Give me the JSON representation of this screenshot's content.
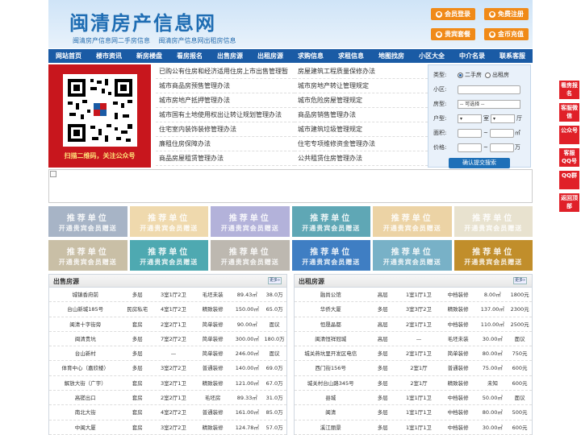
{
  "header": {
    "logo": "闽清房产信息网",
    "tagline": [
      "闽清房产信息网二手房信息",
      "闽清房产信息网出租房信息"
    ],
    "buttons": [
      "会员登录",
      "免费注册",
      "贵宾套餐",
      "金币充值"
    ]
  },
  "nav": [
    "网站首页",
    "楼市资讯",
    "新房楼盘",
    "看房报名",
    "出售房源",
    "出租房源",
    "求购信息",
    "求租信息",
    "地图找房",
    "小区大全",
    "中介名录",
    "联系客服"
  ],
  "qr": {
    "caption": "扫描二维码，关注公众号"
  },
  "links": [
    "已购公有住房和经济适用住房上市出售管理暂",
    "房屋建筑工程质量保修办法",
    "城市商品房预售管理办法",
    "城市房地产转让管理规定",
    "城市房地产抵押管理办法",
    "城市危险房屋管理规定",
    "城市国有土地使用权出让转让规划管理办法",
    "商品房销售管理办法",
    "住宅室内装饰装修管理办法",
    "城市建筑垃圾管理规定",
    "廉租住房保障办法",
    "住宅专项维修资金管理办法",
    "商品房屋租赁管理办法",
    "公共租赁住房管理办法"
  ],
  "search": {
    "type_label": "类型:",
    "type_options": [
      "二手房",
      "出租房"
    ],
    "community_label": "小区:",
    "room_label": "房型:",
    "room_select": "-- 可选择 --",
    "layout_label": "户型:",
    "unit_shi": "室",
    "unit_ting": "厅",
    "area_label": "面积:",
    "area_unit": "㎡",
    "price_label": "价格:",
    "price_unit": "万",
    "range_sep": "~",
    "submit": "确认提交搜索"
  },
  "recommend": {
    "title": "推荐单位",
    "subtitle": "开通贵宾会员赠送",
    "colors": [
      "#a7b4c6",
      "#efd9ad",
      "#b3b2da",
      "#5fa7b5",
      "#ecd3a5",
      "#e8e2cf",
      "#c9bfa6",
      "#4ea9b1",
      "#bdb8b0",
      "#3f7ec3",
      "#78b1c7",
      "#c18e2b"
    ]
  },
  "sale": {
    "title": "出售房源",
    "more": "更多»",
    "rows": [
      [
        "城镇香府前",
        "多层",
        "3室1厅2卫",
        "毛坯未装",
        "89.43㎡",
        "38.0万"
      ],
      [
        "台山新城185号",
        "民房私宅",
        "4室1厅2卫",
        "精致装修",
        "150.00㎡",
        "65.0万"
      ],
      [
        "闽清十字街旁",
        "套房",
        "2室2厅1卫",
        "简单装修",
        "90.00㎡",
        "面议"
      ],
      [
        "闽清贵坑",
        "多层",
        "7室2厅2卫",
        "简单装修",
        "300.00㎡",
        "180.0万"
      ],
      [
        "台山新村",
        "多层",
        "—",
        "简单装修",
        "246.00㎡",
        "面议"
      ],
      [
        "体育中心（嘉欣楼）",
        "多层",
        "3室2厅2卫",
        "普通装修",
        "140.00㎡",
        "69.0万"
      ],
      [
        "解放大街（广宇）",
        "套房",
        "3室2厅1卫",
        "精致装修",
        "121.00㎡",
        "67.0万"
      ],
      [
        "高搓出口",
        "套房",
        "2室2厅1卫",
        "毛坯房",
        "89.33㎡",
        "31.0万"
      ],
      [
        "南北大街",
        "套房",
        "4室2厅2卫",
        "普通装修",
        "161.00㎡",
        "85.0万"
      ],
      [
        "中闽大厦",
        "套房",
        "3室2厅2卫",
        "精致装修",
        "124.78㎡",
        "57.0万"
      ]
    ]
  },
  "rent": {
    "title": "出租房源",
    "more": "更多»",
    "rows": [
      [
        "融尚公馆",
        "高层",
        "1室1厅1卫",
        "中档装修",
        "8.00㎡",
        "1800元"
      ],
      [
        "华侨大厦",
        "多层",
        "3室3厅2卫",
        "精致装修",
        "137.00㎡",
        "2300元"
      ],
      [
        "恒晟晶都",
        "高层",
        "2室1厅1卫",
        "中档装修",
        "110.00㎡",
        "2500元"
      ],
      [
        "闽清恒祥冠城",
        "高层",
        "—",
        "毛坯未装",
        "30.00㎡",
        "面议"
      ],
      [
        "城关燕坑里开发区电信",
        "多层",
        "2室1厅1卫",
        "简单装修",
        "80.00㎡",
        "750元"
      ],
      [
        "西门街156号",
        "多层",
        "2室1厅",
        "普通装修",
        "75.00㎡",
        "600元"
      ],
      [
        "城关村台山路345号",
        "多层",
        "2室1厅",
        "精致装修",
        "未知",
        "600元"
      ],
      [
        "县城",
        "多层",
        "1室1厅1卫",
        "中档装修",
        "50.00㎡",
        "面议"
      ],
      [
        "闽清",
        "多层",
        "1室1厅1卫",
        "中档装修",
        "80.00㎡",
        "500元"
      ],
      [
        "溪江丽景",
        "多层",
        "1室1厅1卫",
        "中档装修",
        "30.00㎡",
        "600元"
      ]
    ]
  },
  "side": [
    "看房报名",
    "客服微信",
    "公众号",
    "客服QQ号",
    "QQ群",
    "返回顶部"
  ]
}
